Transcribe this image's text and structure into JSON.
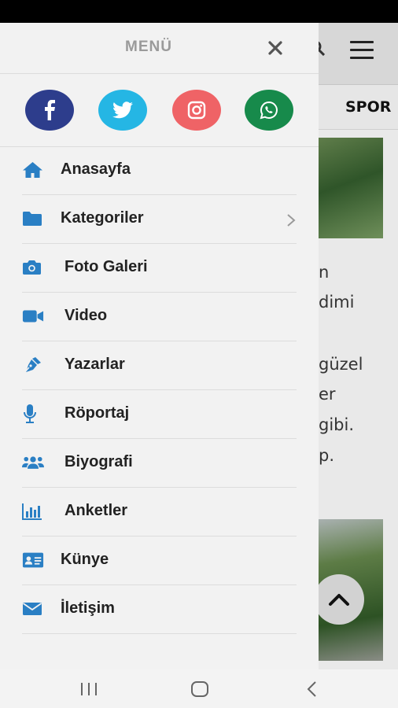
{
  "drawer": {
    "title": "MENÜ",
    "social": [
      {
        "name": "facebook",
        "color": "#2d3d8c",
        "icon": "facebook-icon"
      },
      {
        "name": "twitter",
        "color": "#25b6e4",
        "icon": "twitter-icon"
      },
      {
        "name": "instagram",
        "color": "#ef6366",
        "icon": "instagram-icon"
      },
      {
        "name": "whatsapp",
        "color": "#178a4b",
        "icon": "whatsapp-icon"
      }
    ],
    "items": [
      {
        "label": "Anasayfa",
        "icon": "home-icon"
      },
      {
        "label": "Kategoriler",
        "icon": "folder-icon",
        "has_submenu": true
      },
      {
        "label": "Foto Galeri",
        "icon": "camera-icon"
      },
      {
        "label": "Video",
        "icon": "video-camera-icon"
      },
      {
        "label": "Yazarlar",
        "icon": "pen-icon"
      },
      {
        "label": "Röportaj",
        "icon": "microphone-icon"
      },
      {
        "label": "Biyografi",
        "icon": "users-icon"
      },
      {
        "label": "Anketler",
        "icon": "bar-chart-icon"
      },
      {
        "label": "Künye",
        "icon": "id-card-icon"
      },
      {
        "label": "İletişim",
        "icon": "envelope-icon"
      }
    ],
    "icon_color": "#2a7fc4"
  },
  "background_page": {
    "tab_visible": "SPOR",
    "article_fragments": [
      "n",
      "dimi",
      "güzel",
      "er",
      "gibi.",
      "p."
    ]
  }
}
